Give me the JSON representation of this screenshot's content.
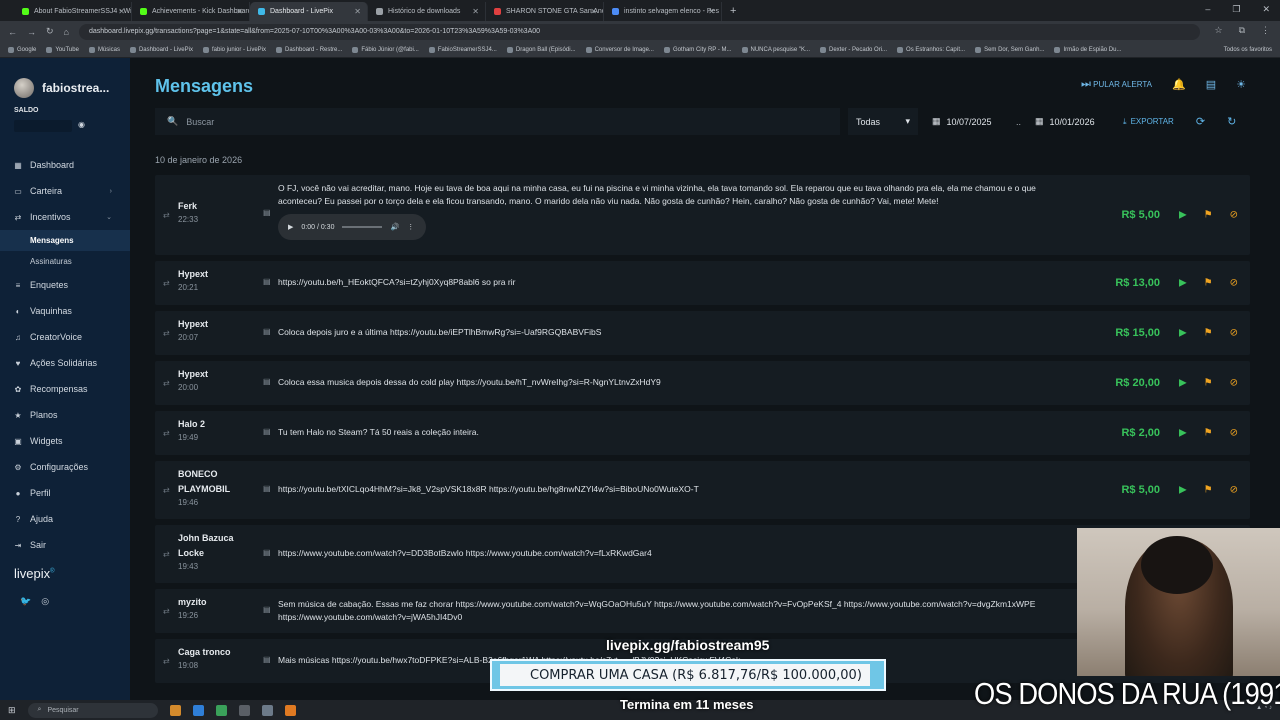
{
  "browser": {
    "tabs": [
      {
        "label": "About FabioStreamerSSJ4 - Wi",
        "color": "#53fc18",
        "active": false
      },
      {
        "label": "Achievements - Kick Dashboard",
        "color": "#53fc18",
        "active": false
      },
      {
        "label": "Dashboard - LivePix",
        "color": "#3fb9e8",
        "active": true
      },
      {
        "label": "Histórico de downloads",
        "color": "#9aa0a6",
        "active": false
      },
      {
        "label": "SHARON STONE GTA San Andre",
        "color": "#e04040",
        "active": false
      },
      {
        "label": "instinto selvagem elenco - Pes",
        "color": "#4c8bf5",
        "active": false
      }
    ],
    "url": "dashboard.livepix.gg/transactions?page=1&state=all&from=2025-07-10T00%3A00%3A00-03%3A00&to=2026-01-10T23%3A59%3A59-03%3A00",
    "bookmarks": [
      "Google",
      "YouTube",
      "Músicas",
      "Dashboard - LivePix",
      "fabio junior - LivePix",
      "Dashboard - Restre...",
      "Fábio Júnior (@fabi...",
      "FabioStreamerSSJ4...",
      "Dragon Ball (Episódi...",
      "Conversor de Image...",
      "Gotham City RP - M...",
      "NUNCA pesquise \"K...",
      "Dexter - Pecado Ori...",
      "Os Estranhos: Capít...",
      "Sem Dor, Sem Ganh...",
      "Irmão de Espião Du..."
    ],
    "bookmarks_all": "Todos os favoritos"
  },
  "sidebar": {
    "username": "fabiostrea...",
    "saldo_label": "SALDO",
    "items": [
      {
        "label": "Dashboard",
        "icon": "grid-icon"
      },
      {
        "label": "Carteira",
        "icon": "wallet-icon",
        "chevron": true
      },
      {
        "label": "Incentivos",
        "icon": "arrows-icon",
        "chevron": true,
        "expanded": true
      },
      {
        "label": "Enquetes",
        "icon": "poll-icon"
      },
      {
        "label": "Vaquinhas",
        "icon": "piggy-icon"
      },
      {
        "label": "CreatorVoice",
        "icon": "voice-icon"
      },
      {
        "label": "Ações Solidárias",
        "icon": "heart-icon"
      },
      {
        "label": "Recompensas",
        "icon": "gift-icon"
      },
      {
        "label": "Planos",
        "icon": "star-icon"
      },
      {
        "label": "Widgets",
        "icon": "widget-icon"
      },
      {
        "label": "Configurações",
        "icon": "gear-icon"
      },
      {
        "label": "Perfil",
        "icon": "user-icon"
      },
      {
        "label": "Ajuda",
        "icon": "help-icon"
      },
      {
        "label": "Sair",
        "icon": "logout-icon"
      }
    ],
    "sub_items": [
      "Mensagens",
      "Assinaturas"
    ],
    "logo": "livepix"
  },
  "main": {
    "title": "Mensagens",
    "pular_alerta": "PULAR ALERTA",
    "search_placeholder": "Buscar",
    "filter_value": "Todas",
    "date_from": "10/07/2025",
    "date_to": "10/01/2026",
    "date_sep": "..",
    "export_label": "EXPORTAR",
    "date_group": "10 de janeiro de 2026",
    "audio": {
      "time": "0:00 / 0:30"
    },
    "messages": [
      {
        "name": "Ferk",
        "time": "22:33",
        "text": "O FJ, você não vai acreditar, mano. Hoje eu tava de boa aqui na minha casa, eu fui na piscina e vi minha vizinha, ela tava tomando sol. Ela reparou que eu tava olhando pra ela, ela me chamou e o que aconteceu? Eu passei por o torço dela e ela ficou transando, mano. O marido dela não viu nada. Não gosta de cunhão? Hein, caralho? Não gosta de cunhão? Vai, mete! Mete!",
        "amount": "R$ 5,00",
        "audio": true
      },
      {
        "name": "Hypext",
        "time": "20:21",
        "text": "https://youtu.be/h_HEoktQFCA?si=tZyhj0Xyq8P8abl6 so pra rir",
        "amount": "R$ 13,00"
      },
      {
        "name": "Hypext",
        "time": "20:07",
        "text": "Coloca depois juro e a última https://youtu.be/iEPTlhBmwRg?si=-Uaf9RGQBABVFibS",
        "amount": "R$ 15,00"
      },
      {
        "name": "Hypext",
        "time": "20:00",
        "text": "Coloca essa musica depois dessa do cold play https://youtu.be/hT_nvWreIhg?si=R-NgnYLtnvZxHdY9",
        "amount": "R$ 20,00"
      },
      {
        "name": "Halo 2",
        "time": "19:49",
        "text": "Tu tem Halo no Steam? Tá 50 reais a coleção inteira.",
        "amount": "R$ 2,00"
      },
      {
        "name": "BONECO PLAYMOBIL",
        "time": "19:46",
        "text": "https://youtu.be/tXICLqo4HhM?si=Jk8_V2spVSK18x8R https://youtu.be/hg8nwNZYl4w?si=BiboUNo0WuteXO-T",
        "amount": "R$ 5,00"
      },
      {
        "name": "John Bazuca Locke",
        "time": "19:43",
        "text": "https://www.youtube.com/watch?v=DD3BotBzwlo https://www.youtube.com/watch?v=fLxRKwdGar4",
        "amount": ""
      },
      {
        "name": "myzito",
        "time": "19:26",
        "text": "Sem música de cabação. Essas me faz chorar https://www.youtube.com/watch?v=WqGOaOHu5uY https://www.youtube.com/watch?v=FvOpPeKSf_4 https://www.youtube.com/watch?v=dvgZkm1xWPE https://www.youtube.com/watch?v=jWA5hJI4Dv0",
        "amount": ""
      },
      {
        "name": "Caga tronco",
        "time": "19:08",
        "text": "Mais músicas https://youtu.be/hwx7toDFPKE?si=ALB-B2a6fbger1WA https://youtu.be/c7yt_..../BJV0?si=UKCasicwFV4Cok",
        "amount": ""
      }
    ]
  },
  "overlay": {
    "channel_url": "livepix.gg/fabiostream95",
    "goal": "COMPRAR UMA CASA (R$ 6.817,76/R$ 100.000,00)",
    "goal_progress": 0.068,
    "ends": "Termina em 11 meses",
    "song": "OS DONOS DA RUA (1991)"
  },
  "taskbar": {
    "search_placeholder": "Pesquisar"
  }
}
